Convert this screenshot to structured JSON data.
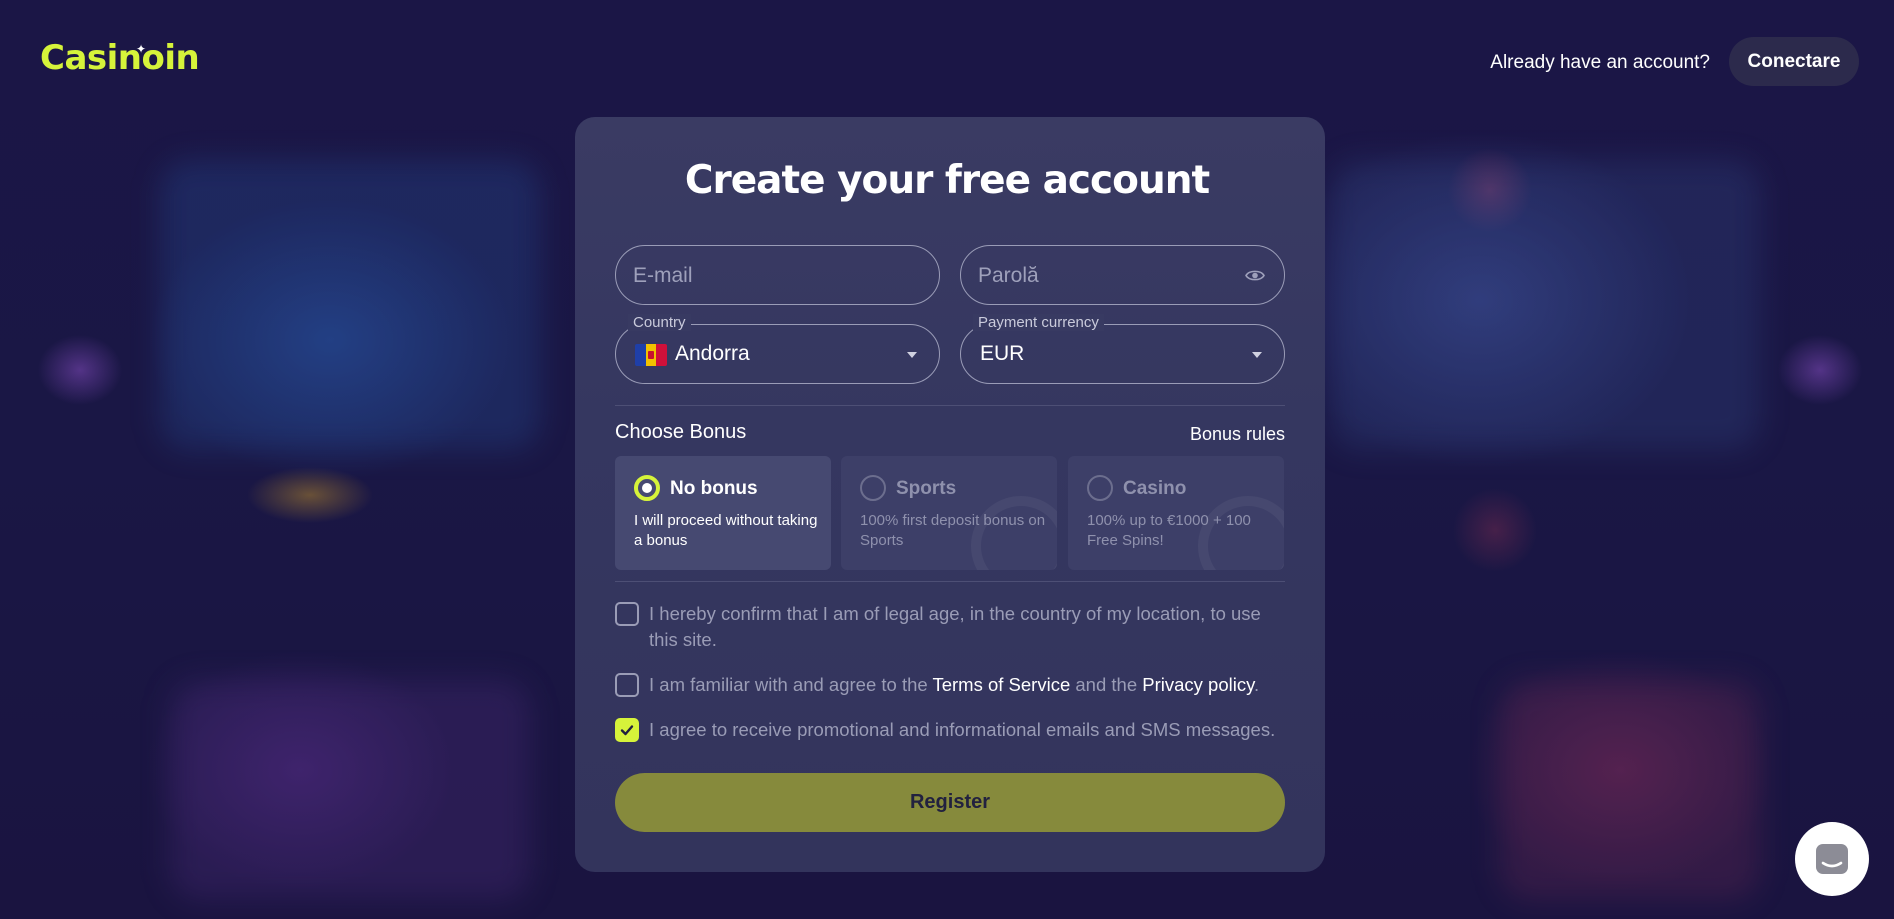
{
  "header": {
    "logo": "Casinoin",
    "already_account": "Already have an account?",
    "login_label": "Conectare"
  },
  "form": {
    "title": "Create your free account",
    "email_placeholder": "E-mail",
    "password_placeholder": "Parolă",
    "country_label": "Country",
    "country_value": "Andorra",
    "currency_label": "Payment currency",
    "currency_value": "EUR"
  },
  "bonus": {
    "heading": "Choose Bonus",
    "rules_link": "Bonus rules",
    "options": [
      {
        "title": "No bonus",
        "desc": "I will proceed without taking a bonus",
        "selected": true
      },
      {
        "title": "Sports",
        "desc": "100% first deposit bonus on Sports",
        "selected": false
      },
      {
        "title": "Casino",
        "desc": "100% up to €1000 + 100 Free Spins!",
        "selected": false
      }
    ]
  },
  "consents": {
    "legal_age": "I hereby confirm that I am of legal age, in the country of my location, to use this site.",
    "terms_prefix": "I am familiar with and agree to the ",
    "terms_link": "Terms of Service",
    "terms_middle": " and the ",
    "privacy_link": "Privacy policy",
    "terms_suffix": ".",
    "promo": "I agree to receive promotional and informational emails and SMS messages.",
    "promo_checked": true
  },
  "register_label": "Register",
  "colors": {
    "accent": "#d6f33a",
    "card": "#363860",
    "background": "#1a1440",
    "register": "#868a3c"
  },
  "icons": {
    "password_toggle": "eye-icon",
    "country_flag": "andorra-flag-icon",
    "dropdown": "chevron-down-icon",
    "chat": "chat-icon",
    "checkmark": "checkmark-icon"
  }
}
